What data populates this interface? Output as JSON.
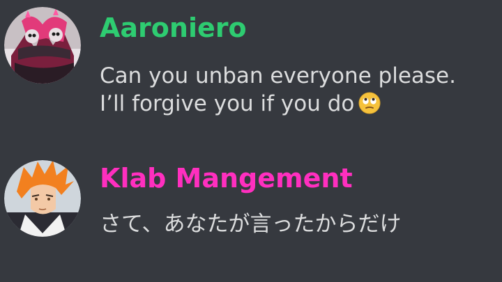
{
  "messages": [
    {
      "username": "Aaroniero",
      "username_color": "#2ecc71",
      "avatar_icon": "anime-avatar-icon",
      "lines": [
        "Can you unban everyone please.",
        "I’ll forgive you if you do"
      ],
      "emoji_icon": "face-with-rolling-eyes-icon"
    },
    {
      "username": "Klab Mangement",
      "username_color": "#ff2fbf",
      "avatar_icon": "anime-avatar-icon",
      "lines": [
        "さて、あなたが言ったからだけ"
      ]
    }
  ],
  "colors": {
    "background": "#36393f",
    "message_text": "#dcddde"
  }
}
